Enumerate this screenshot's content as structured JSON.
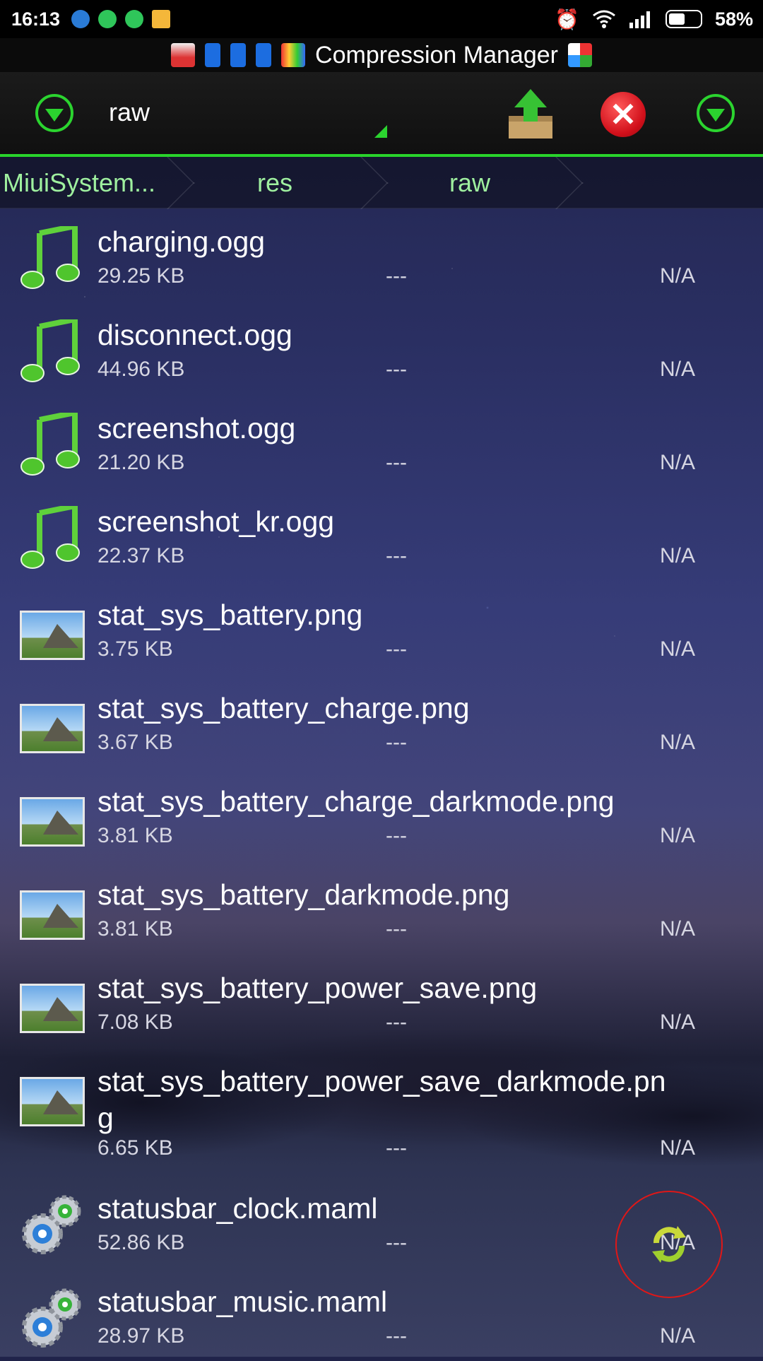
{
  "status_bar": {
    "time": "16:13",
    "battery_percent": "58%",
    "battery_level": 0.58
  },
  "title_bar": {
    "title": "Compression Manager"
  },
  "toolbar": {
    "current_folder": "raw"
  },
  "breadcrumb": [
    "MiuiSystem...",
    "res",
    "raw"
  ],
  "files": [
    {
      "name": "charging.ogg",
      "size": "29.25 KB",
      "date": "---",
      "status": "N/A",
      "type": "audio"
    },
    {
      "name": "disconnect.ogg",
      "size": "44.96 KB",
      "date": "---",
      "status": "N/A",
      "type": "audio"
    },
    {
      "name": "screenshot.ogg",
      "size": "21.20 KB",
      "date": "---",
      "status": "N/A",
      "type": "audio"
    },
    {
      "name": "screenshot_kr.ogg",
      "size": "22.37 KB",
      "date": "---",
      "status": "N/A",
      "type": "audio"
    },
    {
      "name": "stat_sys_battery.png",
      "size": "3.75 KB",
      "date": "---",
      "status": "N/A",
      "type": "image"
    },
    {
      "name": "stat_sys_battery_charge.png",
      "size": "3.67 KB",
      "date": "---",
      "status": "N/A",
      "type": "image"
    },
    {
      "name": "stat_sys_battery_charge_darkmode.png",
      "size": "3.81 KB",
      "date": "---",
      "status": "N/A",
      "type": "image"
    },
    {
      "name": "stat_sys_battery_darkmode.png",
      "size": "3.81 KB",
      "date": "---",
      "status": "N/A",
      "type": "image"
    },
    {
      "name": "stat_sys_battery_power_save.png",
      "size": "7.08 KB",
      "date": "---",
      "status": "N/A",
      "type": "image"
    },
    {
      "name": "stat_sys_battery_power_save_darkmode.pn",
      "name_wrap": "g",
      "size": "6.65 KB",
      "date": "---",
      "status": "N/A",
      "type": "image"
    },
    {
      "name": "statusbar_clock.maml",
      "size": "52.86 KB",
      "date": "---",
      "status": "N/A",
      "type": "settings"
    },
    {
      "name": "statusbar_music.maml",
      "size": "28.97 KB",
      "date": "---",
      "status": "N/A",
      "type": "settings"
    }
  ],
  "colors": {
    "accent_green": "#2bd42f",
    "crumb_green": "#9ff09f",
    "close_red": "#d10f1a"
  }
}
